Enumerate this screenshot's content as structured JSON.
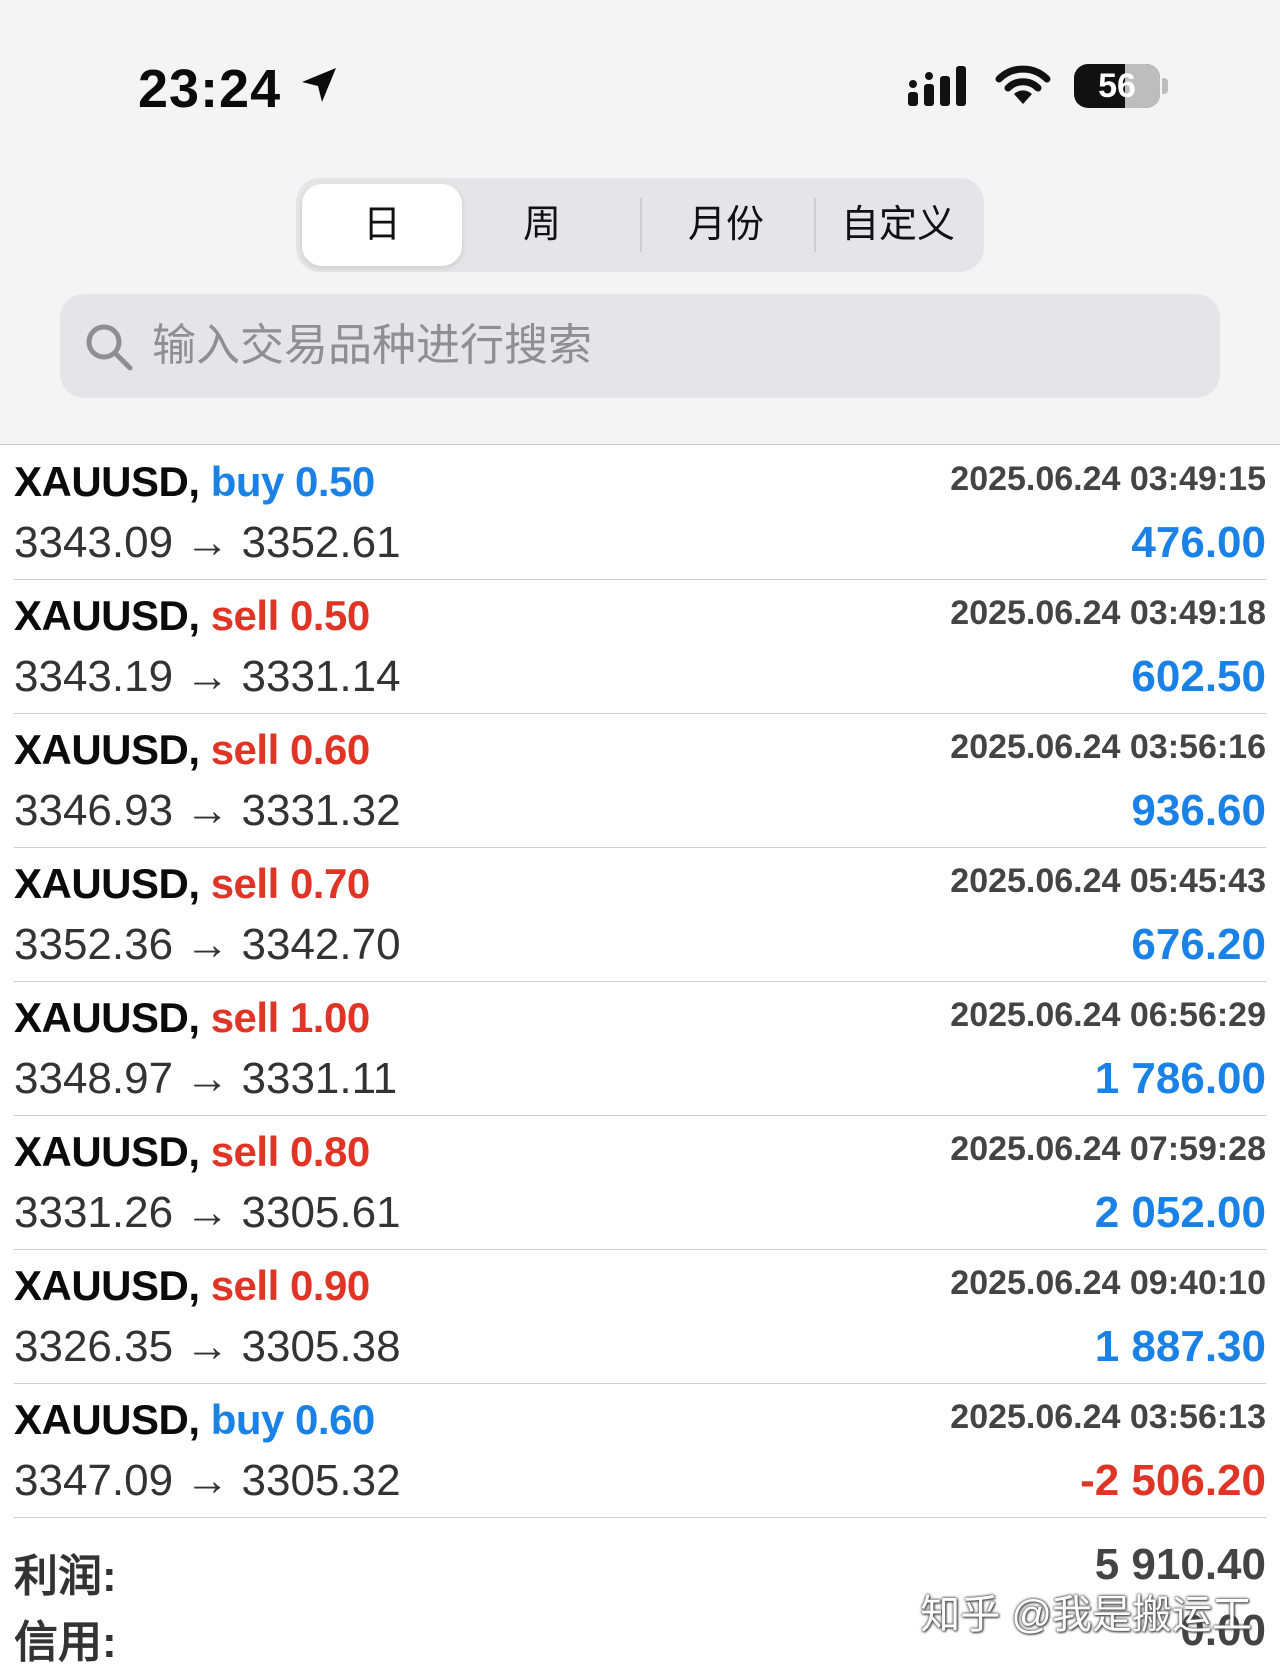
{
  "status": {
    "time": "23:24",
    "battery": "56"
  },
  "segments": {
    "day": "日",
    "week": "周",
    "month": "月份",
    "custom": "自定义"
  },
  "search": {
    "placeholder": "输入交易品种进行搜索"
  },
  "trades": [
    {
      "symbol": "XAUUSD,",
      "side": "buy",
      "volume": "0.50",
      "prices": "3343.09 → 3352.61",
      "datetime": "2025.06.24 03:49:15",
      "profit": "476.00"
    },
    {
      "symbol": "XAUUSD,",
      "side": "sell",
      "volume": "0.50",
      "prices": "3343.19 → 3331.14",
      "datetime": "2025.06.24 03:49:18",
      "profit": "602.50"
    },
    {
      "symbol": "XAUUSD,",
      "side": "sell",
      "volume": "0.60",
      "prices": "3346.93 → 3331.32",
      "datetime": "2025.06.24 03:56:16",
      "profit": "936.60"
    },
    {
      "symbol": "XAUUSD,",
      "side": "sell",
      "volume": "0.70",
      "prices": "3352.36 → 3342.70",
      "datetime": "2025.06.24 05:45:43",
      "profit": "676.20"
    },
    {
      "symbol": "XAUUSD,",
      "side": "sell",
      "volume": "1.00",
      "prices": "3348.97 → 3331.11",
      "datetime": "2025.06.24 06:56:29",
      "profit": "1 786.00"
    },
    {
      "symbol": "XAUUSD,",
      "side": "sell",
      "volume": "0.80",
      "prices": "3331.26 → 3305.61",
      "datetime": "2025.06.24 07:59:28",
      "profit": "2 052.00"
    },
    {
      "symbol": "XAUUSD,",
      "side": "sell",
      "volume": "0.90",
      "prices": "3326.35 → 3305.38",
      "datetime": "2025.06.24 09:40:10",
      "profit": "1 887.30"
    },
    {
      "symbol": "XAUUSD,",
      "side": "buy",
      "volume": "0.60",
      "prices": "3347.09 → 3305.32",
      "datetime": "2025.06.24 03:56:13",
      "profit": "-2 506.20"
    }
  ],
  "summary": {
    "profit_label": "利润:",
    "profit_value": "5 910.40",
    "credit_label": "信用:",
    "credit_value": "0.00"
  },
  "watermark": "知乎 @我是搬运工",
  "colors": {
    "buy": "#1a82e6",
    "sell": "#e03526",
    "positive": "#1a82e6",
    "negative": "#e03526"
  }
}
